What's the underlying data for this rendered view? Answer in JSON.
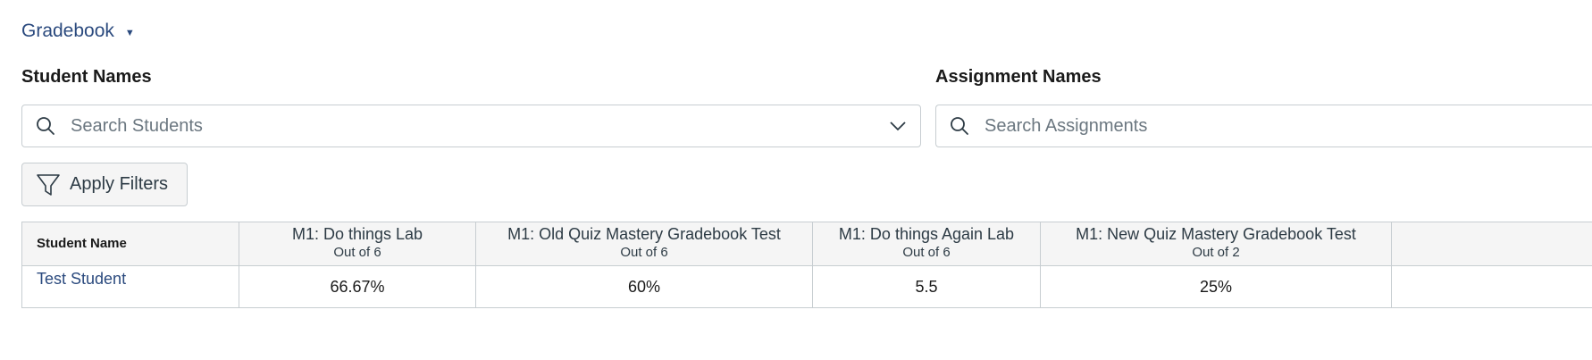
{
  "gradebook_menu": {
    "label": "Gradebook"
  },
  "filters": {
    "student_names_label": "Student Names",
    "student_search_placeholder": "Search Students",
    "assignment_names_label": "Assignment Names",
    "assignment_search_placeholder": "Search Assignments",
    "apply_filters_label": "Apply Filters"
  },
  "icons": {
    "search": "search-icon",
    "chevron": "chevron-down-icon",
    "filter": "filter-icon",
    "caret": "caret-down-icon"
  },
  "colors": {
    "link": "#2b4a7e",
    "border": "#c7cdd1",
    "header_bg": "#f5f5f5",
    "placeholder": "#6b7780"
  },
  "table": {
    "name_header": "Student Name",
    "columns": [
      {
        "title": "M1: Do things Lab",
        "points": "Out of 6"
      },
      {
        "title": "M1: Old Quiz Mastery Gradebook Test",
        "points": "Out of 6"
      },
      {
        "title": "M1: Do things Again Lab",
        "points": "Out of 6"
      },
      {
        "title": "M1: New Quiz Mastery Gradebook Test",
        "points": "Out of 2"
      }
    ],
    "rows": [
      {
        "student": "Test Student",
        "grades": [
          "66.67%",
          "60%",
          "5.5",
          "25%"
        ]
      }
    ]
  }
}
